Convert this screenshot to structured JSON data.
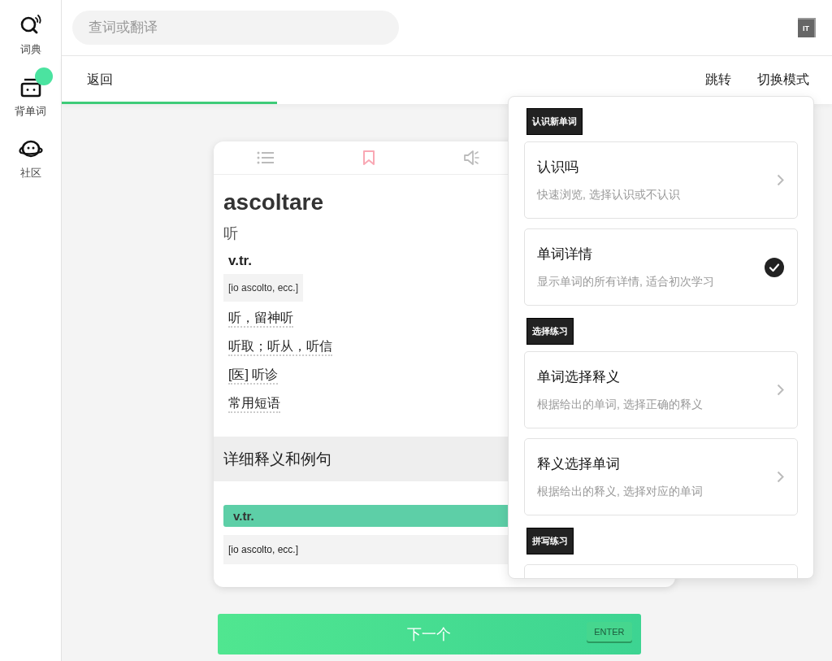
{
  "sidebar": {
    "items": [
      {
        "kind": "dictionary",
        "label": "词典",
        "badge": false
      },
      {
        "kind": "flashcards",
        "label": "背单词",
        "badge": true
      },
      {
        "kind": "community",
        "label": "社区",
        "badge": false
      }
    ]
  },
  "search": {
    "placeholder": "查词或翻译"
  },
  "language_badge": "IT",
  "toolbar": {
    "back": "返回",
    "actions": [
      "跳转",
      "切换模式"
    ]
  },
  "progress": {
    "level": 0.28
  },
  "word_card": {
    "word": "ascoltare",
    "meaning": "听",
    "pos": "v.tr.",
    "grammar": "[io ascolto, ecc.]",
    "definitions": [
      "听，留神听",
      "听取；听从，听信",
      "[医] 听诊",
      "常用短语"
    ],
    "detail_heading": "详细释义和例句",
    "detail_pos": "v.tr.",
    "detail_grammar": "[io ascolto, ecc.]"
  },
  "mode_menu": {
    "sections": [
      {
        "title": "认识新单词",
        "options": [
          {
            "title": "认识吗",
            "description": "快速浏览, 选择认识或不认识",
            "selected": false
          },
          {
            "title": "单词详情",
            "description": "显示单词的所有详情, 适合初次学习",
            "selected": true
          }
        ]
      },
      {
        "title": "选择练习",
        "options": [
          {
            "title": "单词选择释义",
            "description": "根据给出的单词, 选择正确的释义",
            "selected": false
          },
          {
            "title": "释义选择单词",
            "description": "根据给出的释义, 选择对应的单词",
            "selected": false
          }
        ]
      },
      {
        "title": "拼写练习"
      }
    ]
  },
  "next_button": {
    "label": "下一个",
    "shortcut": "ENTER"
  }
}
